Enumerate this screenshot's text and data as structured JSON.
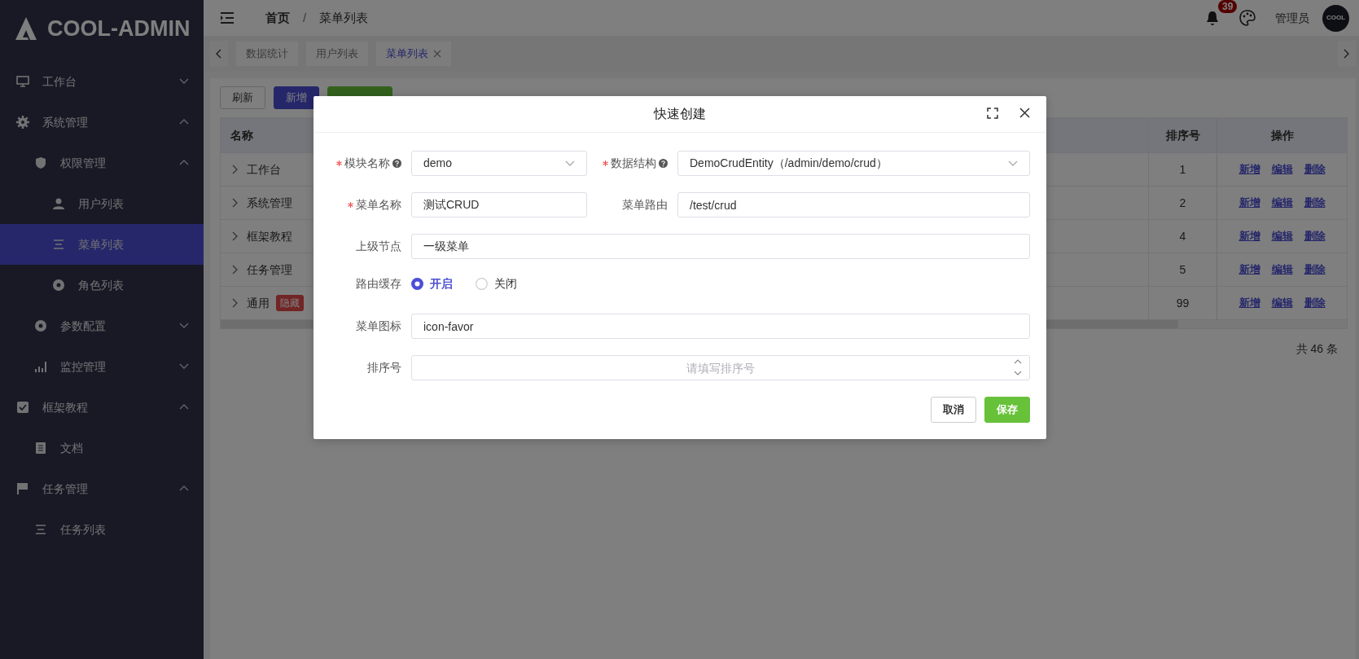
{
  "sidebar": {
    "logo": "COOL-ADMIN",
    "items": [
      {
        "label": "工作台",
        "expanded": false,
        "selected": false
      },
      {
        "label": "系统管理",
        "expanded": true,
        "selected": false,
        "children": [
          {
            "label": "权限管理",
            "expanded": true,
            "selected": false,
            "children": [
              {
                "label": "用户列表",
                "selected": false
              },
              {
                "label": "菜单列表",
                "selected": true
              },
              {
                "label": "角色列表",
                "selected": false
              }
            ]
          },
          {
            "label": "参数配置",
            "expanded": false,
            "selected": false
          },
          {
            "label": "监控管理",
            "expanded": false,
            "selected": false
          }
        ]
      },
      {
        "label": "框架教程",
        "expanded": true,
        "selected": false,
        "children": [
          {
            "label": "文档",
            "selected": false
          }
        ]
      },
      {
        "label": "任务管理",
        "expanded": true,
        "selected": false,
        "children": [
          {
            "label": "任务列表",
            "selected": false
          }
        ]
      }
    ]
  },
  "header": {
    "breadcrumb": [
      {
        "label": "首页"
      },
      {
        "label": "菜单列表"
      }
    ],
    "separator": "/",
    "notifications": "39",
    "user": "管理员",
    "avatar": "COOL"
  },
  "tabs": [
    {
      "label": "数据统计",
      "selected": false
    },
    {
      "label": "用户列表",
      "selected": false
    },
    {
      "label": "菜单列表",
      "selected": true
    }
  ],
  "toolbar": [
    {
      "label": "刷新",
      "kind": "default"
    },
    {
      "label": "新增",
      "kind": "primary"
    },
    {
      "kind": "success"
    }
  ],
  "table": {
    "columns": [
      "名称",
      "排序号",
      "操作"
    ],
    "rows": [
      {
        "name": "工作台",
        "expanded": false,
        "sort": "1",
        "actions": [
          "新增",
          "编辑",
          "删除"
        ]
      },
      {
        "name": "系统管理",
        "expanded": false,
        "sort": "2",
        "actions": [
          "新增",
          "编辑",
          "删除"
        ]
      },
      {
        "name": "框架教程",
        "expanded": false,
        "sort": "4",
        "actions": [
          "新增",
          "编辑",
          "删除"
        ]
      },
      {
        "name": "任务管理",
        "expanded": false,
        "sort": "5",
        "actions": [
          "新增",
          "编辑",
          "删除"
        ]
      },
      {
        "name": "通用",
        "tag": "隐藏",
        "expanded": false,
        "sort": "99",
        "actions": [
          "新增",
          "编辑",
          "删除"
        ]
      }
    ]
  },
  "pagination": {
    "total": "共 46 条"
  },
  "dialog": {
    "title": "快速创建",
    "rows": [
      {
        "fields": [
          {
            "kind": "select",
            "label": "模块名称",
            "required": true,
            "help": true,
            "value": "demo"
          },
          {
            "kind": "select",
            "label": "数据结构",
            "required": true,
            "help": true,
            "value": "DemoCrudEntity（/admin/demo/crud）"
          }
        ]
      },
      {
        "fields": [
          {
            "kind": "input",
            "label": "菜单名称",
            "required": true,
            "value": "测试CRUD"
          },
          {
            "kind": "input",
            "label": "菜单路由",
            "value": "/test/crud"
          }
        ]
      },
      {
        "fields": [
          {
            "kind": "input",
            "label": "上级节点",
            "value": "一级菜单"
          }
        ]
      },
      {
        "fields": [
          {
            "kind": "radio",
            "label": "路由缓存",
            "options": [
              {
                "label": "开启",
                "selected": true
              },
              {
                "label": "关闭",
                "selected": false
              }
            ]
          }
        ]
      },
      {
        "fields": [
          {
            "kind": "input",
            "label": "菜单图标",
            "value": "icon-favor"
          }
        ]
      },
      {
        "fields": [
          {
            "kind": "number",
            "label": "排序号",
            "placeholder": "请填写排序号"
          }
        ]
      }
    ],
    "buttons": [
      {
        "label": "取消",
        "kind": "default"
      },
      {
        "label": "保存",
        "kind": "success"
      }
    ]
  }
}
